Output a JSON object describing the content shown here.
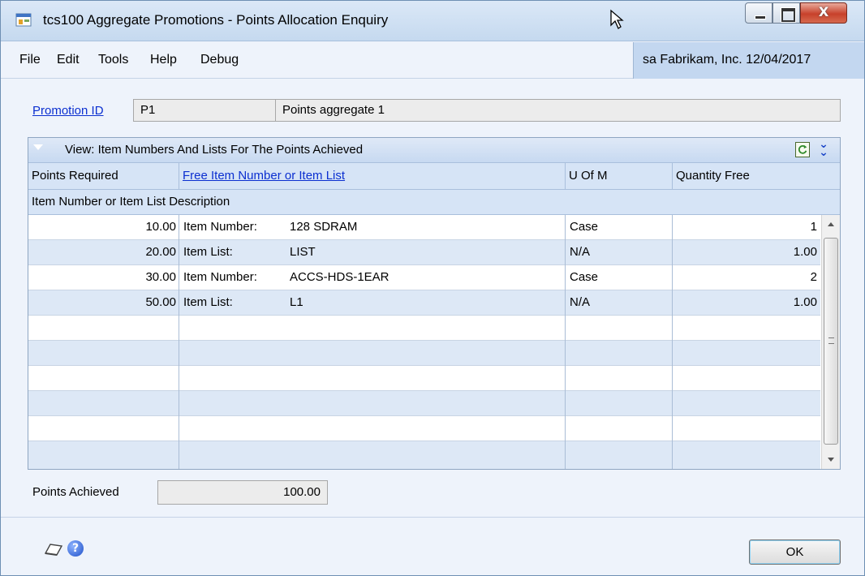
{
  "window": {
    "title": "tcs100 Aggregate Promotions - Points Allocation Enquiry",
    "close_glyph": "X"
  },
  "menu": {
    "items": [
      "File",
      "Edit",
      "Tools",
      "Help",
      "Debug"
    ],
    "company_info": "sa  Fabrikam, Inc. 12/04/2017"
  },
  "promotion": {
    "label": "Promotion ID",
    "id": "P1",
    "description": "Points aggregate 1"
  },
  "grid": {
    "view_label": "View: Item Numbers And Lists For The Points Achieved",
    "columns": [
      "Points Required",
      "Free Item Number or Item List",
      "U Of M",
      "Quantity Free"
    ],
    "subheader": "Item Number or Item List Description",
    "rows": [
      {
        "points": "10.00",
        "type": "Item Number:",
        "item": "128 SDRAM",
        "uom": "Case",
        "qty": "1"
      },
      {
        "points": "20.00",
        "type": "Item List:",
        "item": "LIST",
        "uom": "N/A",
        "qty": "1.00"
      },
      {
        "points": "30.00",
        "type": "Item Number:",
        "item": "ACCS-HDS-1EAR",
        "uom": "Case",
        "qty": "2"
      },
      {
        "points": "50.00",
        "type": "Item List:",
        "item": "L1",
        "uom": "N/A",
        "qty": "1.00"
      }
    ],
    "empty_rows": 6
  },
  "summary": {
    "points_achieved_label": "Points Achieved",
    "points_achieved_value": "100.00"
  },
  "footer": {
    "help_glyph": "?",
    "ok_label": "OK"
  },
  "icons": {
    "app": "app-window-icon",
    "refresh": "refresh-icon",
    "expand": "expand-double-chevron-icon",
    "note": "note-icon",
    "help": "help-icon"
  },
  "colors": {
    "title_bar": "#c5d9ef",
    "grid_header": "#d6e4f6",
    "alt_row": "#dde8f6",
    "link": "#0b2fd0"
  }
}
